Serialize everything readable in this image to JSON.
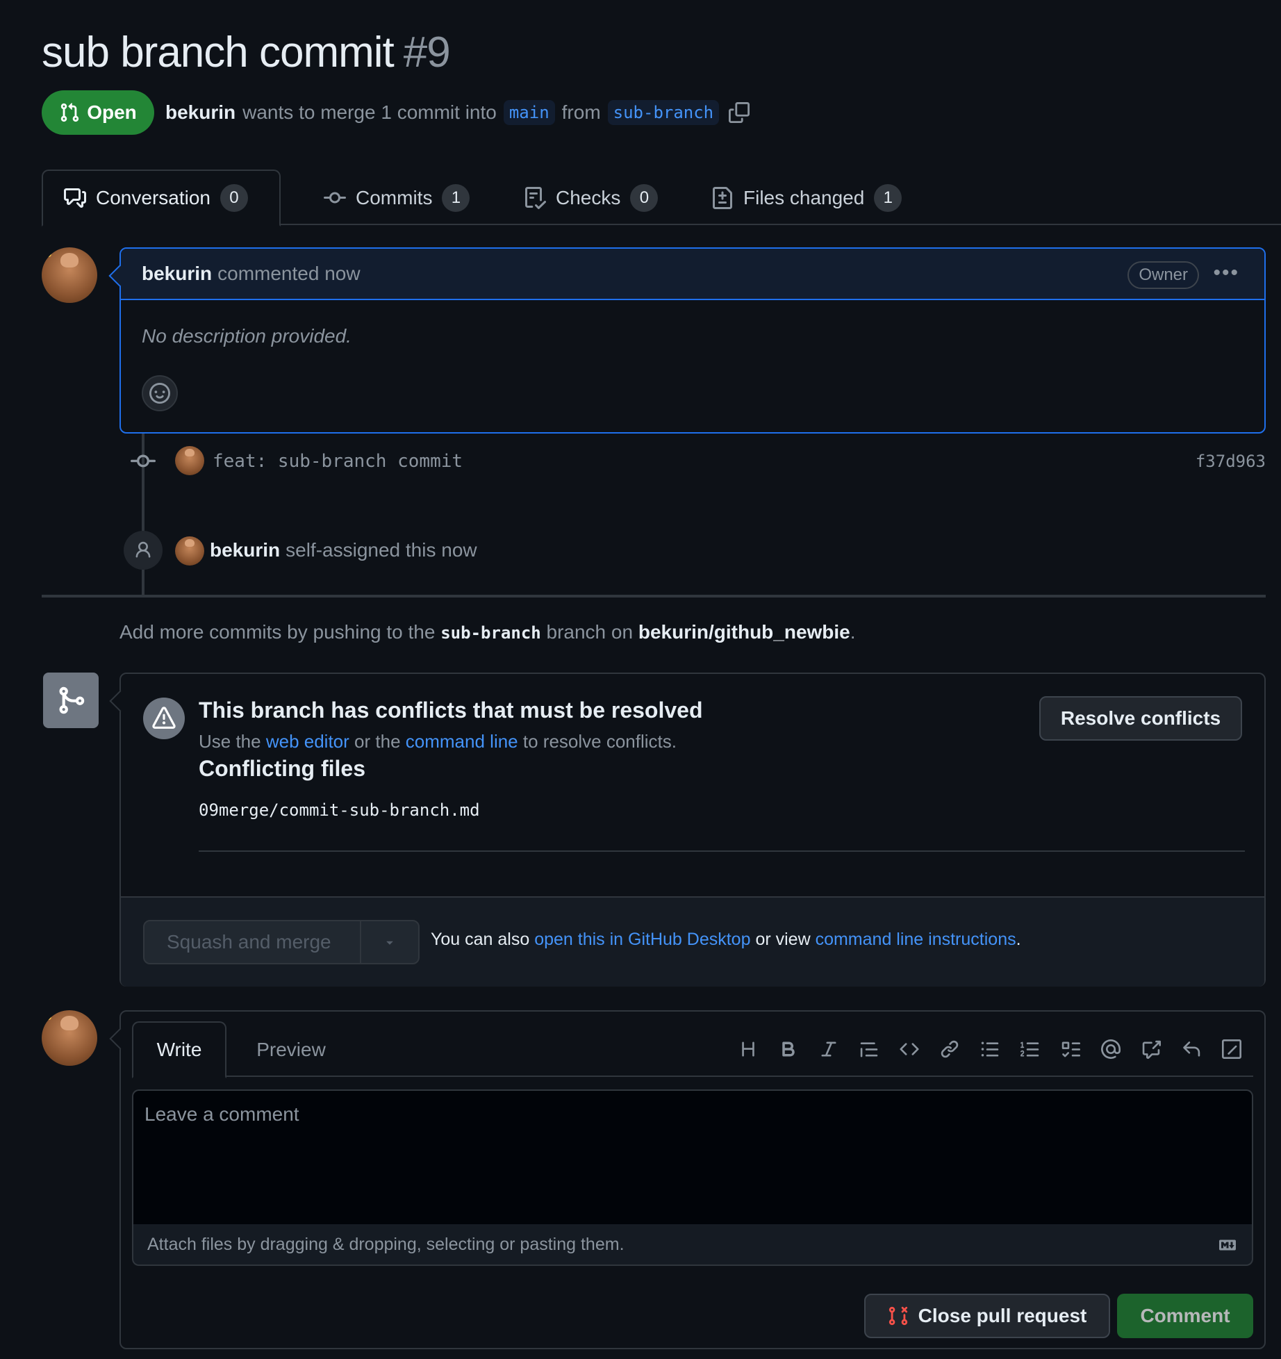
{
  "pr": {
    "title": "sub branch commit",
    "number": "#9",
    "state": "Open",
    "author": "bekurin",
    "merge_text": "wants to merge 1 commit into",
    "base_branch": "main",
    "from_text": "from",
    "head_branch": "sub-branch"
  },
  "tabs": [
    {
      "label": "Conversation",
      "count": "0"
    },
    {
      "label": "Commits",
      "count": "1"
    },
    {
      "label": "Checks",
      "count": "0"
    },
    {
      "label": "Files changed",
      "count": "1"
    }
  ],
  "comment": {
    "author": "bekurin",
    "meta": "commented now",
    "badge": "Owner",
    "body": "No description provided."
  },
  "commit": {
    "message": "feat: sub-branch commit",
    "sha": "f37d963"
  },
  "assign_event": {
    "author": "bekurin",
    "text": "self-assigned this now"
  },
  "add_commits": {
    "prefix": "Add more commits by pushing to the",
    "branch": "sub-branch",
    "middle": "branch on",
    "repo": "bekurin/github_newbie",
    "suffix": "."
  },
  "merge": {
    "conflict_title": "This branch has conflicts that must be resolved",
    "sub_prefix": "Use the",
    "web_editor": "web editor",
    "sub_middle": "or the",
    "command_line": "command line",
    "sub_suffix": "to resolve conflicts.",
    "conflicting_heading": "Conflicting files",
    "file": "09merge/commit-sub-branch.md",
    "resolve_label": "Resolve conflicts",
    "squash_label": "Squash and merge",
    "footer_prefix": "You can also",
    "footer_link1": "open this in GitHub Desktop",
    "footer_middle": "or view",
    "footer_link2": "command line instructions",
    "footer_suffix": "."
  },
  "composer": {
    "write_tab": "Write",
    "preview_tab": "Preview",
    "placeholder": "Leave a comment",
    "attach_text": "Attach files by dragging & dropping, selecting or pasting them.",
    "close_label": "Close pull request",
    "comment_label": "Comment"
  },
  "colors": {
    "background": "#0d1117",
    "accent_green": "#238636",
    "link_blue": "#4493f8",
    "border": "#30363d",
    "danger_red": "#f85149"
  },
  "icons": [
    "pull-request-icon",
    "copy-icon",
    "conversation-icon",
    "commit-icon",
    "checklist-icon",
    "file-diff-icon",
    "smiley-icon",
    "person-icon",
    "git-merge-icon",
    "alert-icon",
    "triangle-down-icon",
    "heading-icon",
    "bold-icon",
    "italic-icon",
    "quote-icon",
    "code-icon",
    "link-icon",
    "unordered-list-icon",
    "ordered-list-icon",
    "task-list-icon",
    "mention-icon",
    "cross-reference-icon",
    "reply-icon",
    "slash-icon",
    "markdown-icon",
    "git-pull-request-closed-icon"
  ]
}
